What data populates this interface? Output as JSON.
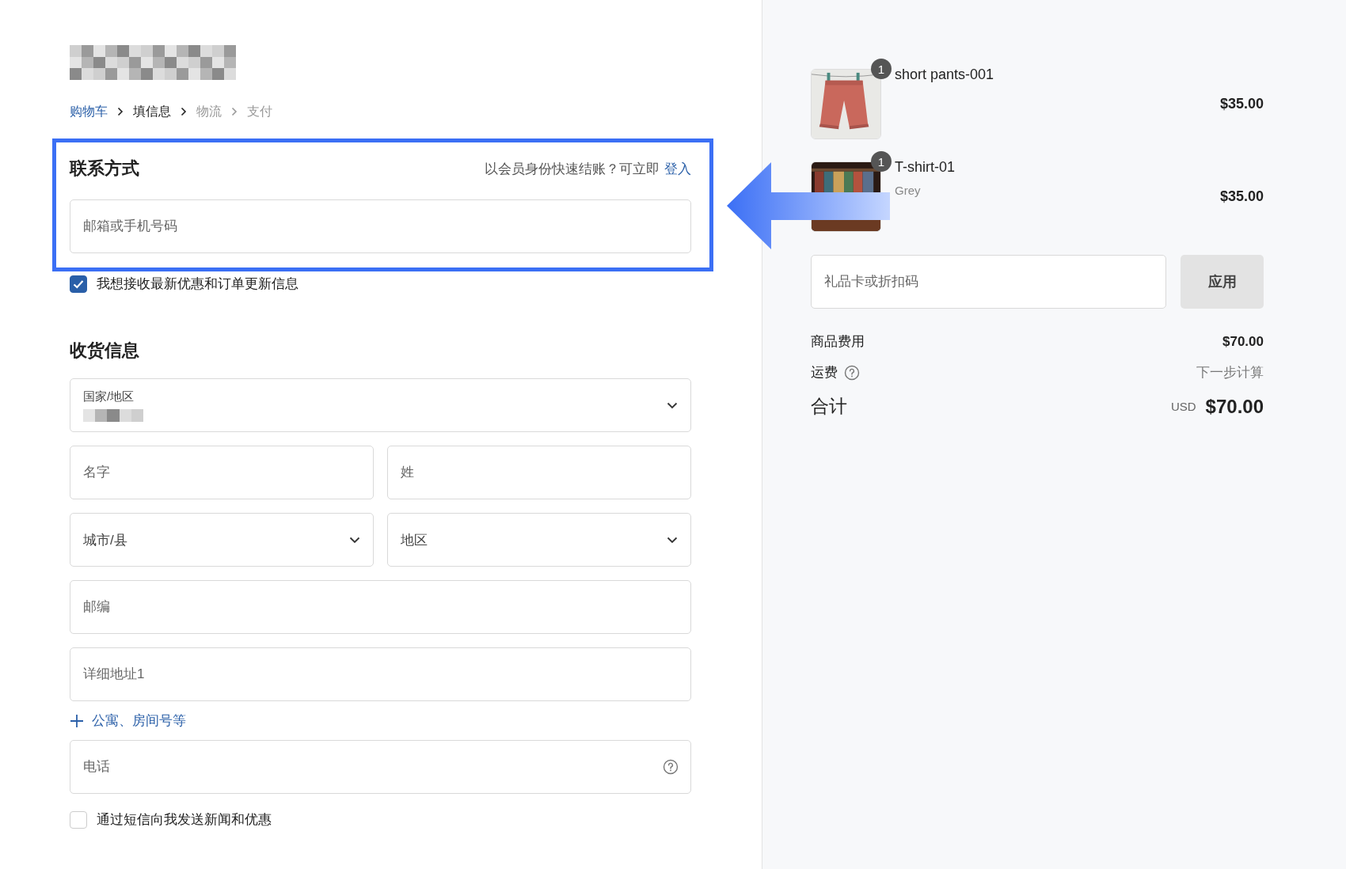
{
  "breadcrumb": [
    {
      "label": "购物车",
      "kind": "link"
    },
    {
      "label": "填信息",
      "kind": "current"
    },
    {
      "label": "物流",
      "kind": "upcoming"
    },
    {
      "label": "支付",
      "kind": "upcoming"
    }
  ],
  "contact": {
    "title": "联系方式",
    "login_prompt": "以会员身份快速结账？可立即",
    "login_link": "登入",
    "email": {
      "placeholder": "邮箱或手机号码"
    },
    "newsletter": {
      "label": "我想接收最新优惠和订单更新信息",
      "checked": true
    }
  },
  "shipping": {
    "title": "收货信息",
    "rows": [
      {
        "kind": "fields",
        "fields": [
          {
            "kind": "country",
            "label": "国家/地区"
          }
        ]
      },
      {
        "kind": "fields",
        "fields": [
          {
            "kind": "text",
            "placeholder": "名字"
          },
          {
            "kind": "text",
            "placeholder": "姓"
          }
        ]
      },
      {
        "kind": "fields",
        "fields": [
          {
            "kind": "select",
            "placeholder": "城市/县"
          },
          {
            "kind": "select",
            "placeholder": "地区"
          }
        ]
      },
      {
        "kind": "fields",
        "fields": [
          {
            "kind": "text",
            "placeholder": "邮编"
          }
        ]
      },
      {
        "kind": "fields",
        "fields": [
          {
            "kind": "text",
            "placeholder": "详细地址1"
          }
        ]
      },
      {
        "kind": "link",
        "label": "公寓、房间号等"
      },
      {
        "kind": "fields",
        "fields": [
          {
            "kind": "help",
            "placeholder": "电话"
          }
        ]
      },
      {
        "kind": "checkbox",
        "label": "通过短信向我发送新闻和优惠",
        "checked": false
      }
    ]
  },
  "cart": {
    "items": [
      {
        "name": "short pants-001",
        "quantity": "1",
        "price": "$35.00",
        "kind": "shorts"
      },
      {
        "name": "T-shirt-01",
        "variant": "Grey",
        "quantity": "1",
        "price": "$35.00",
        "kind": "rack"
      }
    ],
    "discount": {
      "placeholder": "礼品卡或折扣码",
      "button": "应用"
    },
    "subtotal": {
      "label": "商品费用",
      "value": "$70.00"
    },
    "shipping": {
      "label": "运费",
      "value": "下一步计算"
    },
    "total": {
      "label": "合计",
      "currency": "USD",
      "value": "$70.00"
    }
  }
}
